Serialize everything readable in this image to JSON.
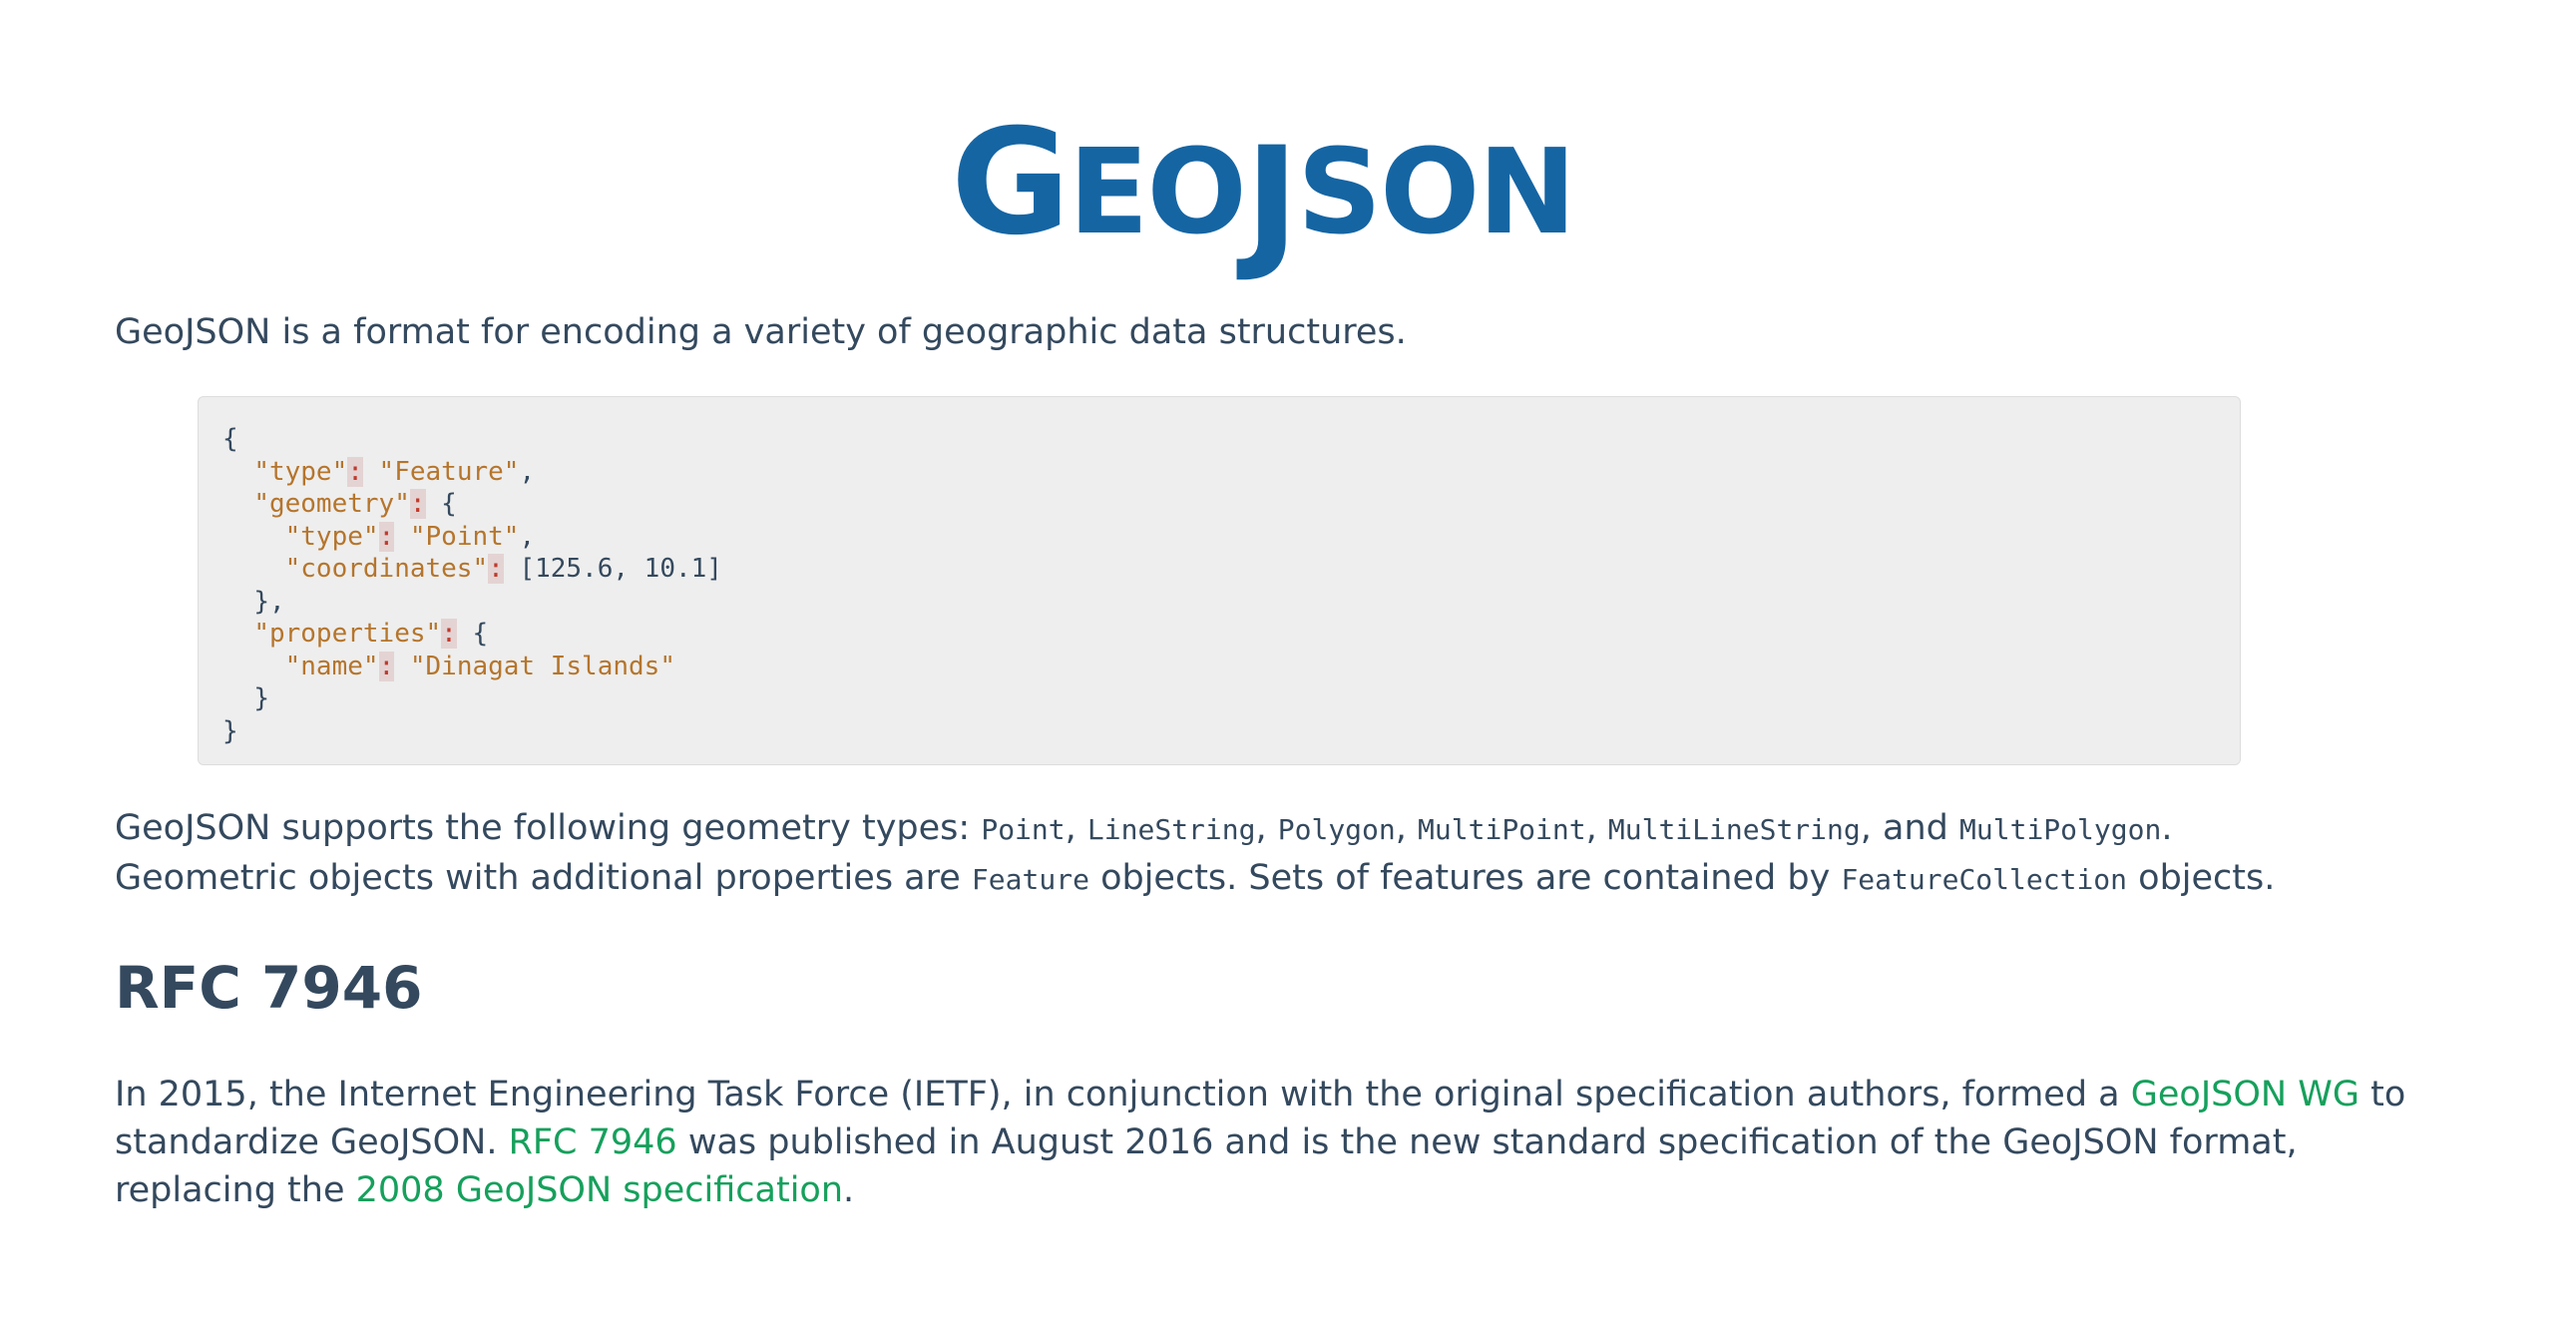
{
  "logo": {
    "letters": [
      "G",
      "EO",
      "J",
      "SON"
    ]
  },
  "intro": "GeoJSON is a format for encoding a variety of geographic data structures.",
  "code": {
    "line1": "{",
    "type_key": "\"type\"",
    "type_val": "\"Feature\"",
    "geometry_key": "\"geometry\"",
    "open_brace": "{",
    "geom_type_key": "\"type\"",
    "geom_type_val": "\"Point\"",
    "coordinates_key": "\"coordinates\"",
    "coordinates_val": "[125.6, 10.1]",
    "close_geom": "},",
    "properties_key": "\"properties\"",
    "name_key": "\"name\"",
    "name_val": "\"Dinagat Islands\"",
    "close_props": "}",
    "close_all": "}",
    "colon": ":",
    "comma": ","
  },
  "types_paragraph": {
    "lead": "GeoJSON supports the following geometry types:",
    "types": [
      "Point",
      "LineString",
      "Polygon",
      "MultiPoint",
      "MultiLineString",
      "MultiPolygon"
    ],
    "and": "and",
    "line2_a": "Geometric objects with additional properties are",
    "feature": "Feature",
    "line2_b": "objects. Sets of features are contained by",
    "feature_collection": "FeatureCollection",
    "line2_c": "objects."
  },
  "rfc_heading": "RFC 7946",
  "rfc_paragraph": {
    "part1": "In 2015, the Internet Engineering Task Force (IETF), in conjunction with the original specification authors, formed a",
    "link_wg": "GeoJSON WG",
    "part2": "to",
    "part3": "standardize GeoJSON.",
    "link_rfc": "RFC 7946",
    "part4": "was published in August 2016 and is the new standard specification of the GeoJSON format,",
    "part5": "replacing the",
    "link_2008": "2008 GeoJSON specification",
    "part6": "."
  },
  "colors": {
    "logo": "#1565a3",
    "text": "#34495e",
    "link": "#16a05c",
    "code_key": "#b5752c",
    "code_colon": "#c0392b",
    "code_bg": "#eeeeee"
  }
}
